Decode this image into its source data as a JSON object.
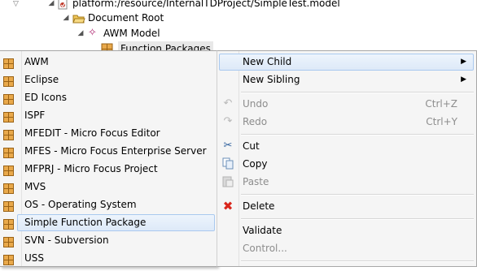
{
  "tree": {
    "items": [
      {
        "label": "platform:/resource/InternalTDProject/SimpleTest.model"
      },
      {
        "label": "Document Root"
      },
      {
        "label": "AWM Model"
      },
      {
        "label": "Function Packages"
      }
    ]
  },
  "child_menu": {
    "items": [
      {
        "label": "AWM"
      },
      {
        "label": "Eclipse"
      },
      {
        "label": "ED Icons"
      },
      {
        "label": "ISPF"
      },
      {
        "label": "MFEDIT - Micro Focus Editor"
      },
      {
        "label": "MFES - Micro Focus Enterprise Server"
      },
      {
        "label": "MFPRJ - Micro Focus Project"
      },
      {
        "label": "MVS"
      },
      {
        "label": "OS - Operating System"
      },
      {
        "label": "Simple Function Package"
      },
      {
        "label": "SVN - Subversion"
      },
      {
        "label": "USS"
      }
    ],
    "highlighted_index": 9
  },
  "context_menu": {
    "new_child": "New Child",
    "new_sibling": "New Sibling",
    "undo": "Undo",
    "undo_shortcut": "Ctrl+Z",
    "redo": "Redo",
    "redo_shortcut": "Ctrl+Y",
    "cut": "Cut",
    "copy": "Copy",
    "paste": "Paste",
    "delete": "Delete",
    "validate": "Validate",
    "control": "Control..."
  },
  "colors": {
    "highlight": "#dde9f8",
    "highlight_border": "#a9c9ef",
    "menu_bg": "#f5f5f5",
    "package_icon": "#e0a23c",
    "delete_icon": "#d9261c"
  }
}
